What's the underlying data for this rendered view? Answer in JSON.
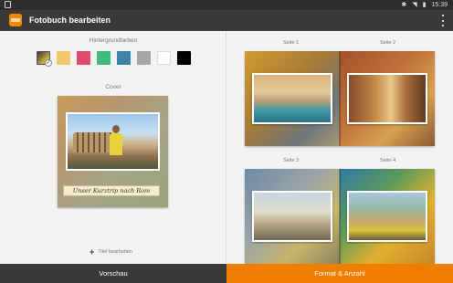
{
  "status_bar": {
    "time": "15:39",
    "icons": [
      "gallery-notification-icon",
      "bluetooth-icon",
      "wifi-icon",
      "battery-icon"
    ]
  },
  "toolbar": {
    "title": "Fotobuch bearbeiten"
  },
  "left_panel": {
    "background_label": "Hintergrundfarben",
    "swatches": [
      {
        "color": "photo-gradient",
        "selected": true
      },
      {
        "color": "#f2c86e",
        "selected": false
      },
      {
        "color": "#e04a6e",
        "selected": false
      },
      {
        "color": "#3dba7e",
        "selected": false
      },
      {
        "color": "#3e83a8",
        "selected": false
      },
      {
        "color": "#a6a6a6",
        "selected": false
      },
      {
        "color": "#ffffff",
        "selected": false
      },
      {
        "color": "#000000",
        "selected": false
      }
    ],
    "cover_label": "Cover",
    "cover_title": "Unser Kurztrip nach Rom",
    "title_edit_label": "Titel bearbeiten"
  },
  "right_panel": {
    "pages": [
      {
        "label": "Seite 1"
      },
      {
        "label": "Seite 2"
      },
      {
        "label": "Seite 3"
      },
      {
        "label": "Seite 4"
      }
    ]
  },
  "bottom_bar": {
    "preview_label": "Vorschau",
    "format_label": "Format & Anzahl"
  },
  "colors": {
    "accent": "#ef7d00",
    "toolbar": "#3a3a3a",
    "status_bar": "#2e2e2e",
    "background": "#f2f2f2"
  }
}
